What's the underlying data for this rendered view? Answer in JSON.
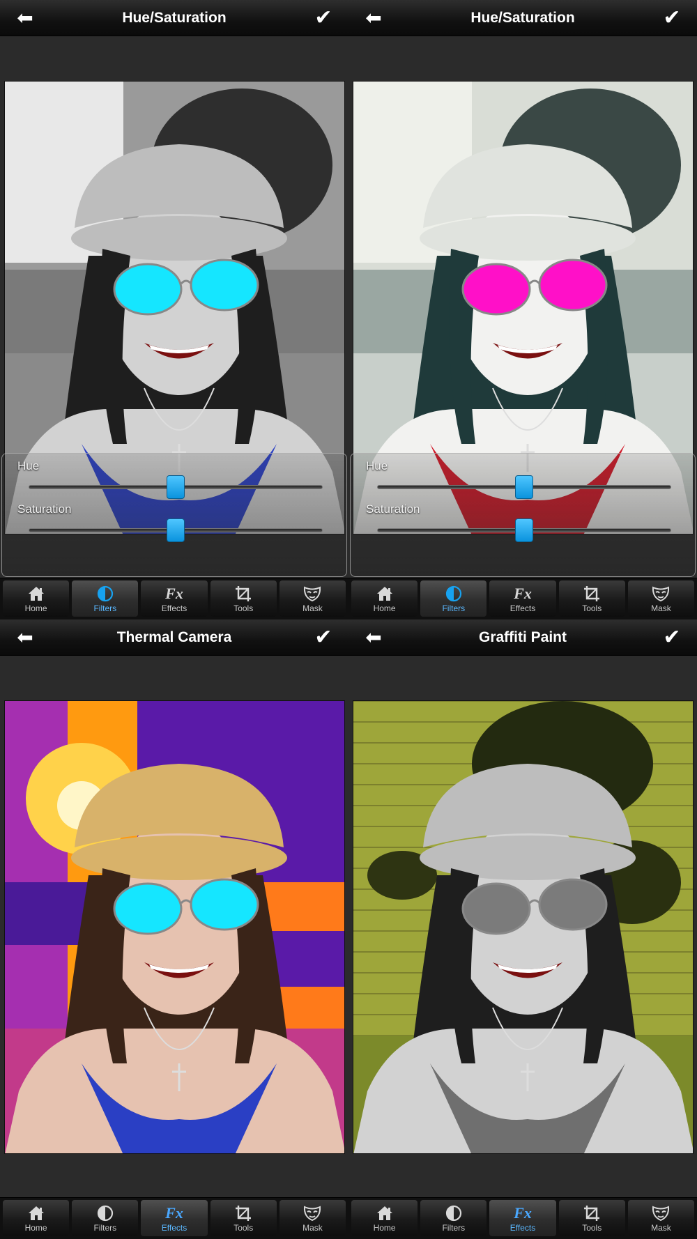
{
  "panels": [
    {
      "title": "Hue/Saturation",
      "sliders": [
        {
          "label": "Hue",
          "value": 0.5
        },
        {
          "label": "Saturation",
          "value": 0.5
        }
      ],
      "active_tab": "Filters",
      "lens_color": "#15e6ff",
      "top_color": "#2a3fc4",
      "bg_tint": "#9a9a9a"
    },
    {
      "title": "Hue/Saturation",
      "sliders": [
        {
          "label": "Hue",
          "value": 0.5
        },
        {
          "label": "Saturation",
          "value": 0.5
        }
      ],
      "active_tab": "Filters",
      "lens_color": "#ff10c8",
      "top_color": "#d11827",
      "bg_tint": "#c9d3cf"
    },
    {
      "title": "Thermal Camera",
      "active_tab": "Effects",
      "lens_color": "#15e6ff",
      "top_color": "#2a3fc4",
      "bg_tint": "#ff9a10"
    },
    {
      "title": "Graffiti Paint",
      "active_tab": "Effects",
      "lens_color": "#7b7b7b",
      "top_color": "#6f6f6f",
      "bg_tint": "#a7a645"
    }
  ],
  "tabs": [
    {
      "label": "Home",
      "icon": "home-icon"
    },
    {
      "label": "Filters",
      "icon": "filters-icon"
    },
    {
      "label": "Effects",
      "icon": "effects-icon"
    },
    {
      "label": "Tools",
      "icon": "crop-icon"
    },
    {
      "label": "Mask",
      "icon": "mask-icon"
    }
  ],
  "colors": {
    "accent": "#17a2f0",
    "active_label": "#5bb8ff"
  }
}
